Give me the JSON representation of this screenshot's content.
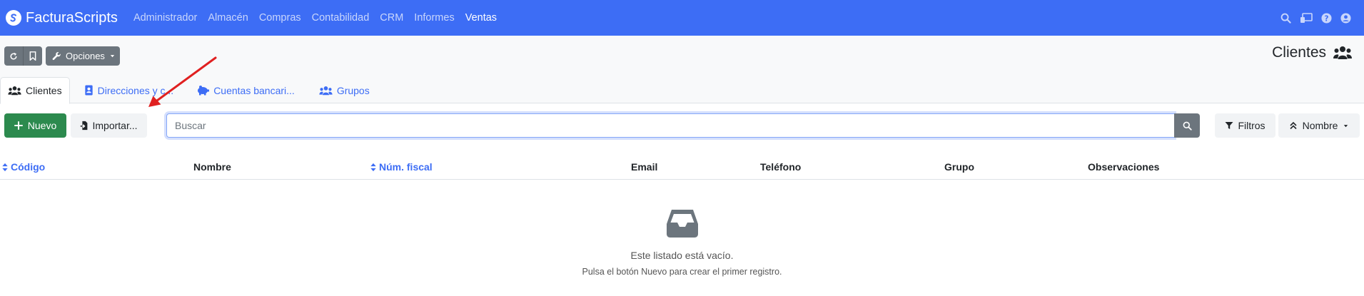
{
  "navbar": {
    "brand": "FacturaScripts",
    "menu": [
      "Administrador",
      "Almacén",
      "Compras",
      "Contabilidad",
      "CRM",
      "Informes",
      "Ventas"
    ],
    "active": "Ventas",
    "icons": [
      "search-icon",
      "dashboard-icon",
      "help-icon",
      "user-icon"
    ],
    "color": "#3d6df5"
  },
  "toolbar": {
    "refresh_icon": "refresh-icon",
    "bookmark_icon": "bookmark-icon",
    "options_label": "Opciones"
  },
  "page": {
    "title": "Clientes"
  },
  "tabs": [
    {
      "label": "Clientes",
      "icon": "users-icon",
      "active": true
    },
    {
      "label": "Direcciones y c...",
      "icon": "address-book-icon",
      "active": false
    },
    {
      "label": "Cuentas bancari...",
      "icon": "piggy-bank-icon",
      "active": false
    },
    {
      "label": "Grupos",
      "icon": "users-icon",
      "active": false
    }
  ],
  "actions": {
    "new_label": "Nuevo",
    "import_label": "Importar...",
    "search_placeholder": "Buscar",
    "filters_label": "Filtros",
    "order_label": "Nombre"
  },
  "table": {
    "columns": [
      {
        "label": "Código",
        "sortable": true
      },
      {
        "label": "Nombre",
        "sortable": false
      },
      {
        "label": "Núm. fiscal",
        "sortable": true
      },
      {
        "label": "Email",
        "sortable": false
      },
      {
        "label": "Teléfono",
        "sortable": false
      },
      {
        "label": "Grupo",
        "sortable": false
      },
      {
        "label": "Observaciones",
        "sortable": false
      }
    ]
  },
  "empty": {
    "message": "Este listado está vacío.",
    "hint": "Pulsa el botón Nuevo para crear el primer registro."
  },
  "colors": {
    "accent": "#3d6df5",
    "success": "#2c8a4e",
    "secondary": "#6c757d",
    "annotation": "#e02020"
  }
}
